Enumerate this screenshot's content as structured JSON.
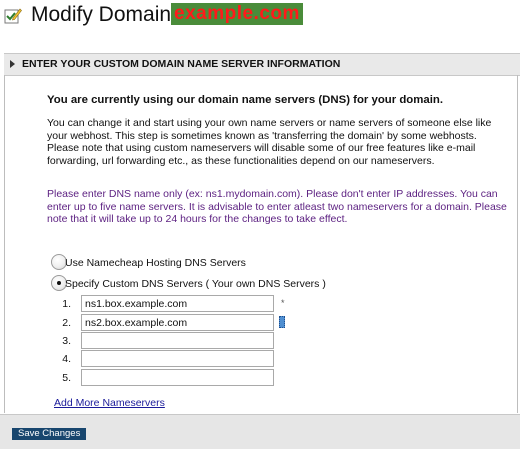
{
  "page": {
    "title_prefix": "Modify Domain:",
    "domain": "example.com"
  },
  "section": {
    "title": "ENTER YOUR CUSTOM DOMAIN NAME SERVER INFORMATION"
  },
  "main": {
    "status": "You are currently using our domain name servers (DNS) for your domain.",
    "explanation": "You can change it and start using your own name servers or name servers of someone else like your webhost. This step is sometimes known as 'transferring the domain' by some webhosts. Please note that using custom nameservers will disable some of our free features like e-mail forwarding, url forwarding etc., as these functionalities depend on our nameservers.",
    "notice": "Please enter DNS name only (ex: ns1.mydomain.com). Please don't enter IP addresses. You can enter up to five name servers. It is advisable to enter atleast two nameservers for a domain. Please note that it will take up to 24 hours for the changes to take effect."
  },
  "options": {
    "namecheap_label": "Use Namecheap Hosting DNS Servers",
    "custom_label": "Specify Custom DNS Servers ( Your own DNS Servers )",
    "selected": "custom"
  },
  "nameservers": [
    {
      "num": "1.",
      "value": "ns1.box.example.com",
      "required": "*"
    },
    {
      "num": "2.",
      "value": "ns2.box.example.com"
    },
    {
      "num": "3.",
      "value": ""
    },
    {
      "num": "4.",
      "value": ""
    },
    {
      "num": "5.",
      "value": ""
    }
  ],
  "links": {
    "add_more": "Add More Nameservers"
  },
  "footer": {
    "save_label": "Save Changes"
  },
  "colors": {
    "domain_badge_bg": "#4a8c3a",
    "domain_badge_text": "#ff1a1a",
    "notice_text": "#5b1f80",
    "save_button_bg": "#18466e"
  },
  "icons": {
    "title": "edit-checkbox-icon",
    "section": "triangle-right-icon"
  }
}
